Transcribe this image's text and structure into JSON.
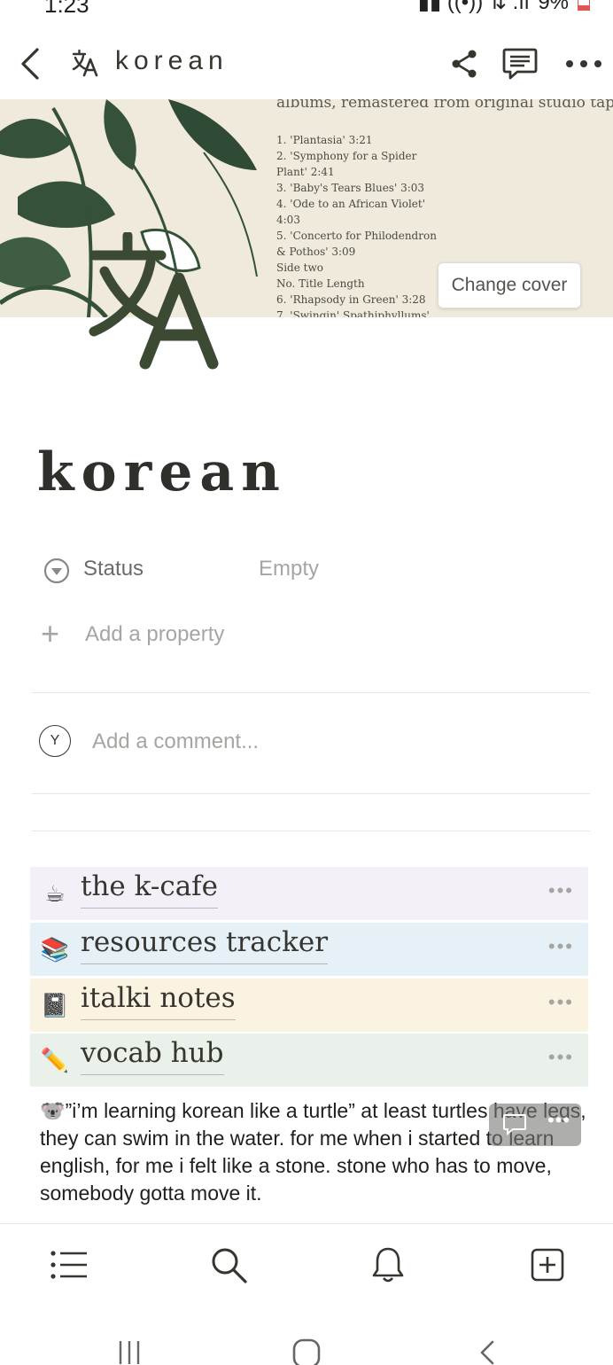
{
  "status_bar": {
    "time": "1:23",
    "battery": "9%"
  },
  "topbar": {
    "title": "korean"
  },
  "cover": {
    "heading": "albums, remastered from original studio tapes",
    "tracks": [
      "1. 'Plantasia'  3:21",
      "2. 'Symphony for a Spider",
      "Plant'  2:41",
      "3. 'Baby's Tears Blues'  3:03",
      "4. 'Ode to an African Violet'",
      "4:03",
      "5. 'Concerto for Philodendron",
      "& Pothos'  3:09",
      "Side two",
      "No.  Title Length",
      "6. 'Rhapsody in Green'  3:28",
      "7. 'Swingin' Spathiphyllums'"
    ],
    "change_cover_label": "Change cover"
  },
  "page": {
    "title": "korean"
  },
  "properties": [
    {
      "name": "Status",
      "value": "Empty"
    }
  ],
  "add_property_label": "Add a property",
  "comment": {
    "avatar_initial": "Y",
    "placeholder": "Add a comment..."
  },
  "links": [
    {
      "emoji": "☕",
      "title": "the k-cafe",
      "bg": "#f3f1f7"
    },
    {
      "emoji": "📚",
      "title": "resources tracker",
      "bg": "#e6f0f7"
    },
    {
      "emoji": "📓",
      "title": "italki notes",
      "bg": "#fbf3e2"
    },
    {
      "emoji": "✏️",
      "title": "vocab hub",
      "bg": "#eaf0ea"
    }
  ],
  "quote": {
    "emoji": "🐨",
    "text": "”i’m learning korean like a turtle” at least turtles have legs, they can swim in the water. for me when i started to learn english, for me i felt like a stone. stone who has to move, somebody gotta move it."
  },
  "colors": {
    "accent_green": "#3d4a33",
    "text": "#37352f",
    "muted": "#a6a5a1"
  },
  "icons": {
    "topbar": [
      "back-icon",
      "translate-icon",
      "share-icon",
      "comment-icon",
      "more-icon"
    ],
    "bottom_nav": [
      "list-icon",
      "search-icon",
      "bell-icon",
      "add-page-icon"
    ],
    "system_nav": [
      "recents-icon",
      "home-icon",
      "system-back-icon"
    ]
  }
}
